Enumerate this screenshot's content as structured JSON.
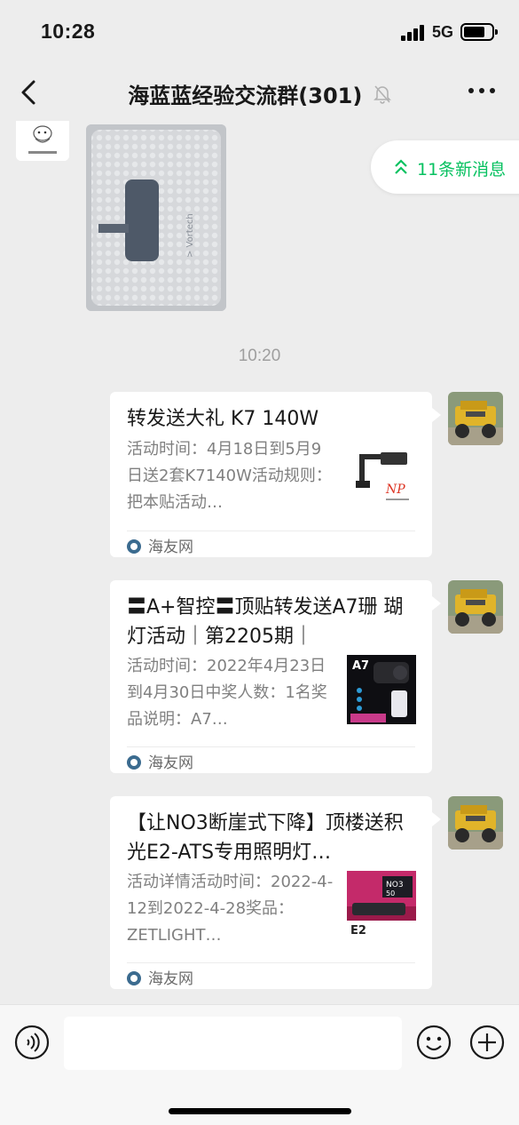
{
  "status_bar": {
    "time": "10:28",
    "network": "5G"
  },
  "header": {
    "title": "海蓝蓝经验交流群(301)"
  },
  "new_messages_pill": {
    "label": "11条新消息"
  },
  "timestamp": "10:20",
  "messages": [
    {
      "title": "转发送大礼 K7 140W",
      "description": "活动时间：4月18日到5月9日送2套K7140W活动规则：把本贴活动…",
      "source": "海友网"
    },
    {
      "title": "〓A+智控〓顶贴转发送A7珊 瑚灯活动｜第2205期｜",
      "description": "活动时间：2022年4月23日到4月30日中奖人数：1名奖品说明：A7…",
      "source": "海友网"
    },
    {
      "title": "【让NO3断崖式下降】顶楼送积光E2-ATS专用照明灯…",
      "description": "活动详情活动时间：2022-4-12到2022-4-28奖品：ZETLIGHT…",
      "source": "海友网"
    }
  ],
  "input_bar": {
    "placeholder": ""
  },
  "colors": {
    "accent": "#07c160",
    "background": "#ededed",
    "card": "#ffffff"
  }
}
